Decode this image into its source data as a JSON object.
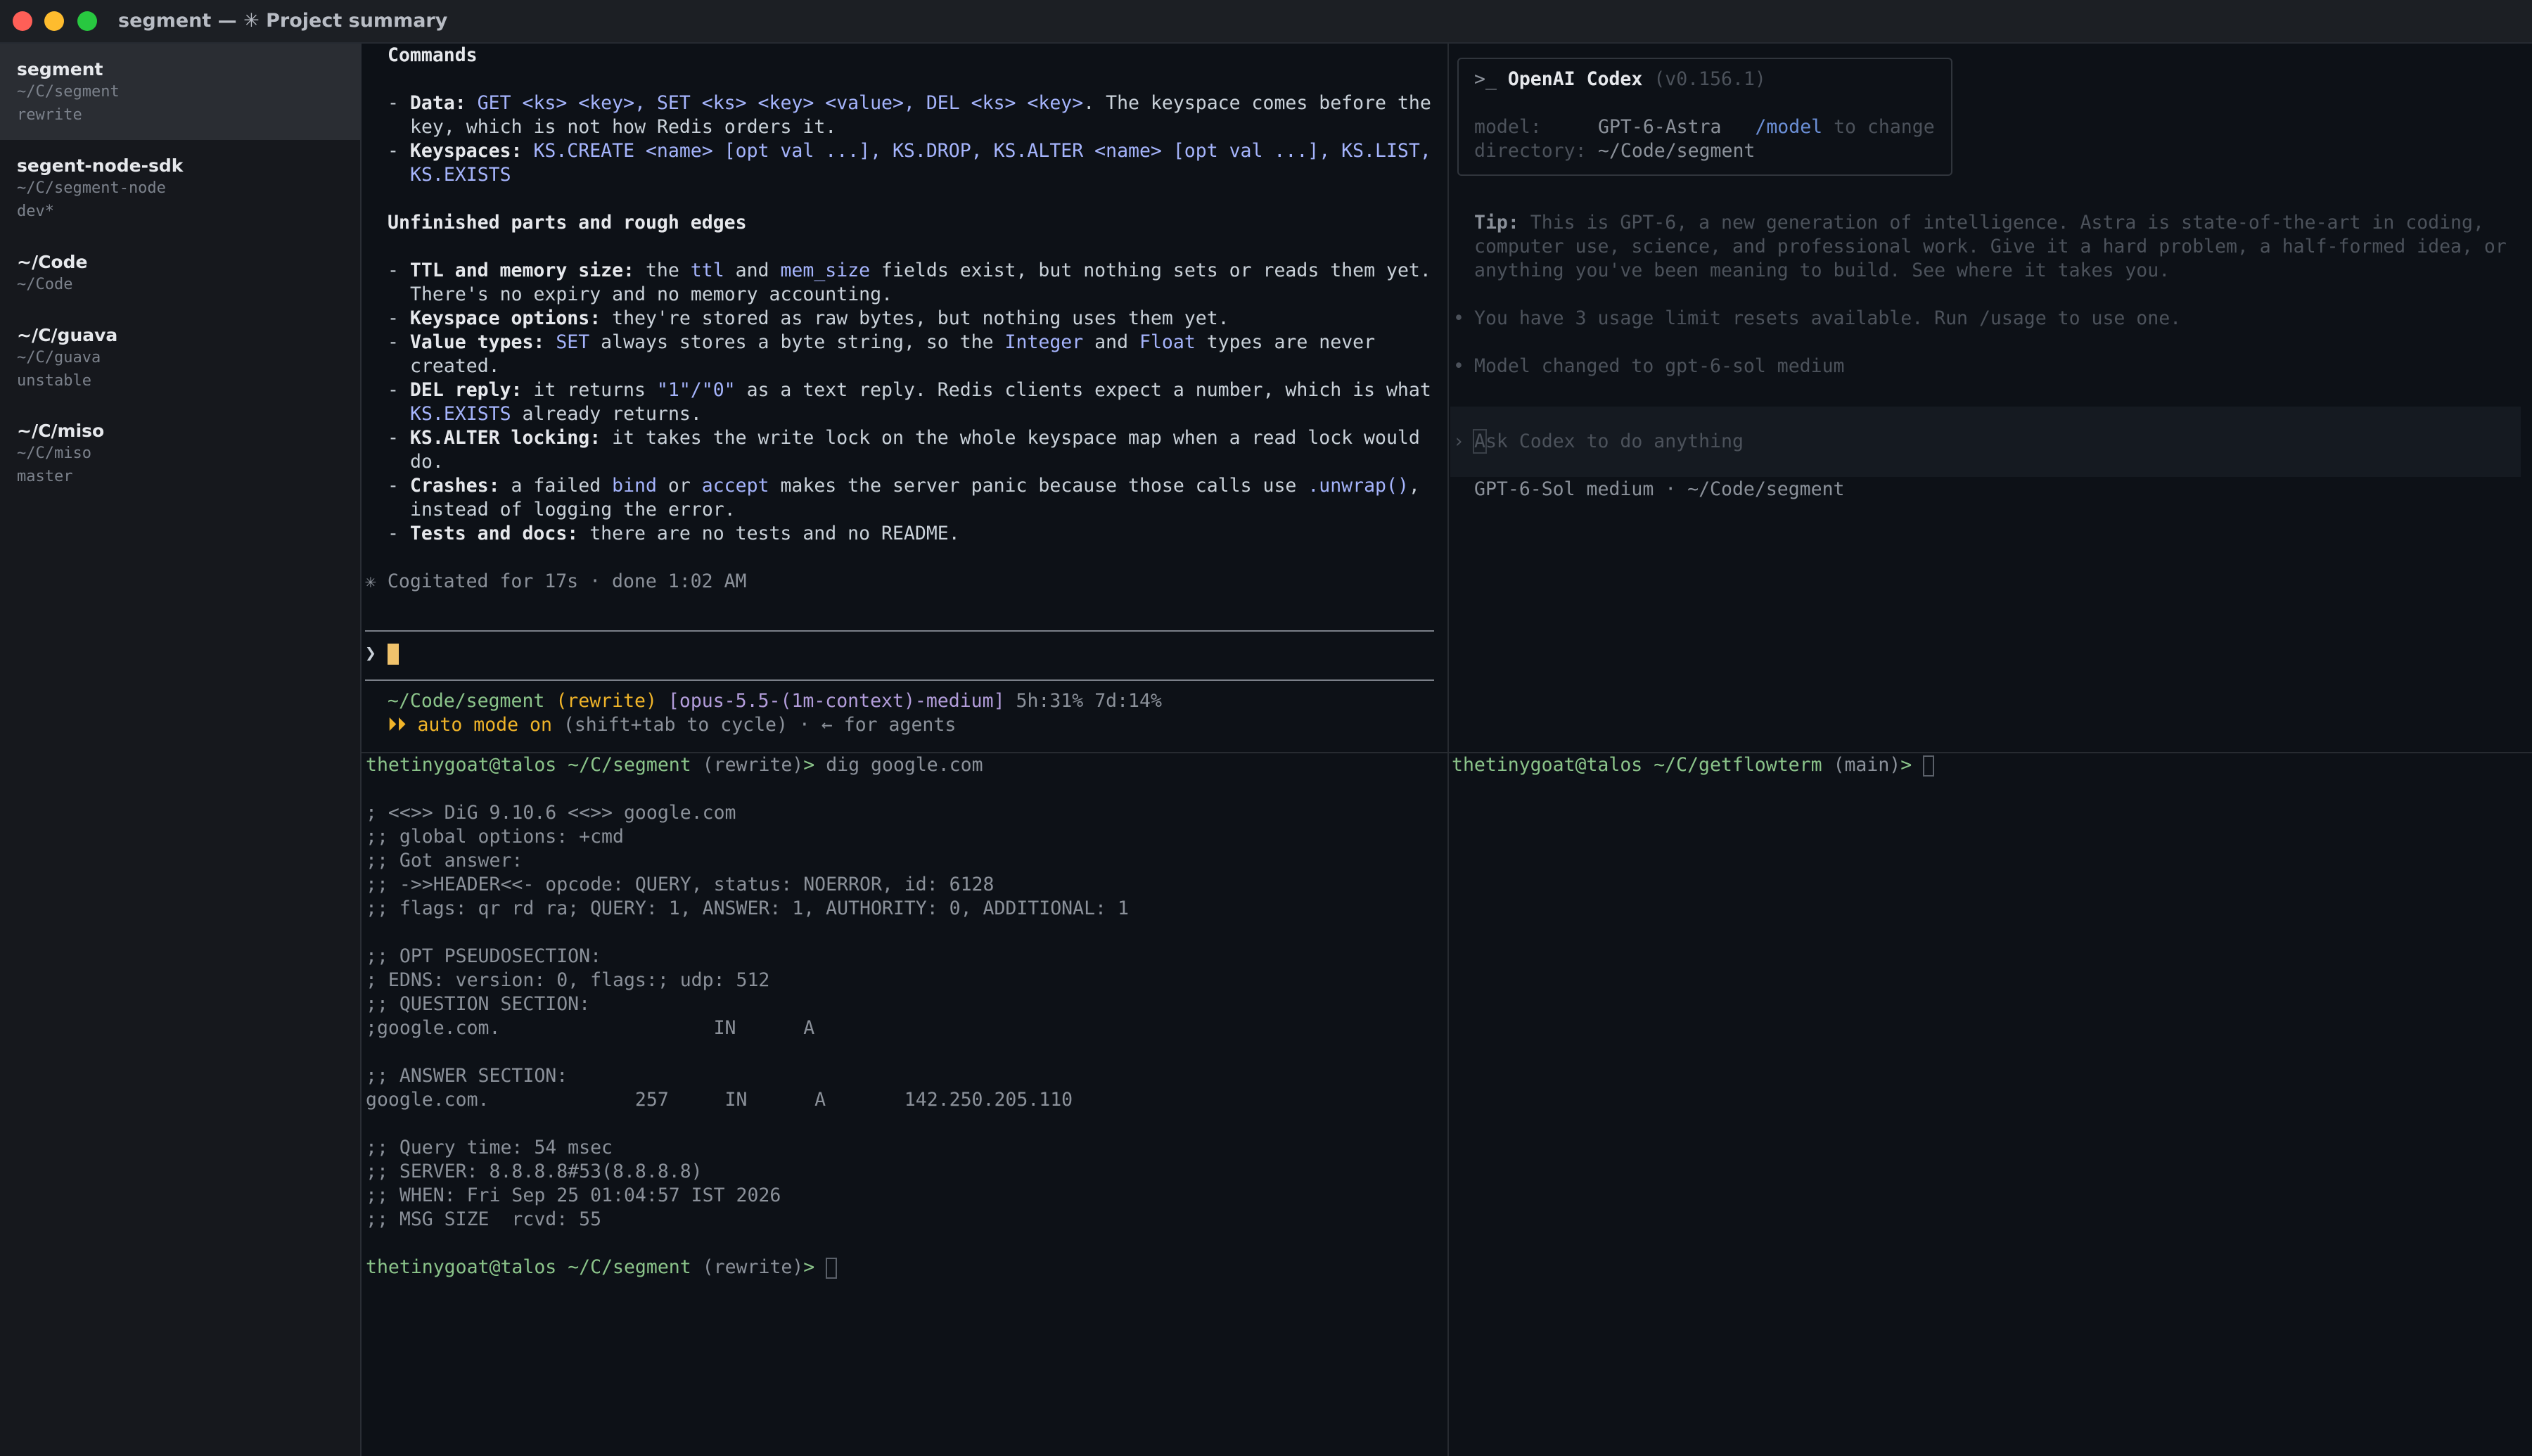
{
  "window": {
    "title": "segment — ✳ Project summary",
    "traffic_lights": {
      "close": "#ff5f57",
      "minimize": "#febc2e",
      "zoom": "#28c840"
    }
  },
  "sidebar": {
    "items": [
      {
        "name": "segment",
        "path": "~/C/segment",
        "branch": "rewrite",
        "active": true
      },
      {
        "name": "segent-node-sdk",
        "path": "~/C/segment-node",
        "branch": "dev*"
      },
      {
        "name": "~/Code",
        "path": "~/Code",
        "branch": ""
      },
      {
        "name": "~/C/guava",
        "path": "~/C/guava",
        "branch": "unstable"
      },
      {
        "name": "~/C/miso",
        "path": "~/C/miso",
        "branch": "master"
      }
    ]
  },
  "claude_pane": {
    "commands_heading": "Commands",
    "data_label": "Data:",
    "data_cmds": "GET <ks> <key>, SET <ks> <key> <value>, DEL <ks> <key>",
    "data_note_1": ". The keyspace comes before the",
    "data_note_2": "key, which is not how Redis orders it.",
    "ks_label": "Keyspaces:",
    "ks_cmds_1": "KS.CREATE <name> [opt val ...], KS.DROP, KS.ALTER <name> [opt val ...], KS.LIST,",
    "ks_cmds_2": "KS.EXISTS",
    "unfinished_heading": "Unfinished parts and rough edges",
    "ttl_label": "TTL and memory size:",
    "ttl_the": " the ",
    "ttl_code1": "ttl",
    "ttl_and": " and ",
    "ttl_code2": "mem_size",
    "ttl_rest": " fields exist, but nothing sets or reads them yet.",
    "ttl_line2": "There's no expiry and no memory accounting.",
    "keyspace_label": "Keyspace options:",
    "keyspace_text": " they're stored as raw bytes, but nothing uses them yet.",
    "valuetypes_label": "Value types:",
    "vt_code1": "SET",
    "vt_text1": " always stores a byte string, so the ",
    "vt_code2": "Integer",
    "vt_and": " and ",
    "vt_code3": "Float",
    "vt_text2": " types are never",
    "vt_line2": "created.",
    "del_label": "DEL reply:",
    "del_text1": " it returns ",
    "del_code": "\"1\"/\"0\"",
    "del_text2": " as a text reply. Redis clients expect a number, which is what",
    "del_code2": "KS.EXISTS",
    "del_text3": " already returns.",
    "alter_label": "KS.ALTER locking:",
    "alter_text": " it takes the write lock on the whole keyspace map when a read lock would",
    "alter_line2": "do.",
    "crash_label": "Crashes:",
    "crash_text1": " a failed ",
    "crash_code1": "bind",
    "crash_or": " or ",
    "crash_code2": "accept",
    "crash_text2": " makes the server panic because those calls use ",
    "crash_code3": ".unwrap()",
    "crash_comma": ",",
    "crash_line2": "instead of logging the error.",
    "tests_label": "Tests and docs:",
    "tests_text": " there are no tests and no README.",
    "dash": "- ",
    "cogitated": "✳ Cogitated for 17s · done 1:02 AM",
    "prompt_char": "❯",
    "status_path": "~/Code/segment",
    "status_branch": "(rewrite)",
    "status_model": "[opus-5.5-(1m-context)-medium]",
    "status_usage": "5h:31% 7d:14%",
    "auto_arrows": "⏵⏵",
    "auto_mode": "auto mode on",
    "auto_rest": " (shift+tab to cycle) · ← for agents"
  },
  "codex_pane": {
    "header_prompt": ">_",
    "header_name": "OpenAI Codex",
    "header_version": "(v0.156.1)",
    "model_label": "model:",
    "model_value": "GPT-6-Astra",
    "model_cmd": "/model",
    "model_hint": "to change",
    "dir_label": "directory:",
    "dir_value": "~/Code/segment",
    "tip_label": "Tip:",
    "tip_line1": "This is GPT-6, a new generation of intelligence. Astra is state-of-the-art in coding,",
    "tip_line2": "computer use, science, and professional work. Give it a hard problem, a half-formed idea, or",
    "tip_line3": "anything you've been meaning to build. See where it takes you.",
    "bullet": "•",
    "notice1": "You have 3 usage limit resets available. Run /usage to use one.",
    "notice2": "Model changed to gpt-6-sol medium",
    "input_prompt": "›",
    "input_first_char": "A",
    "input_placeholder": "sk Codex to do anything",
    "footer": "GPT-6-Sol medium · ~/Code/segment"
  },
  "terminal_left": {
    "user_host": "thetinygoat@talos",
    "path": "~/C/segment",
    "branch": "(rewrite)",
    "prompt_sym": ">",
    "command": "dig google.com",
    "output": [
      "; <<>> DiG 9.10.6 <<>> google.com",
      ";; global options: +cmd",
      ";; Got answer:",
      ";; ->>HEADER<<- opcode: QUERY, status: NOERROR, id: 6128",
      ";; flags: qr rd ra; QUERY: 1, ANSWER: 1, AUTHORITY: 0, ADDITIONAL: 1",
      "",
      ";; OPT PSEUDOSECTION:",
      "; EDNS: version: 0, flags:; udp: 512",
      ";; QUESTION SECTION:",
      ";google.com.                   IN      A",
      "",
      ";; ANSWER SECTION:",
      "google.com.             257     IN      A       142.250.205.110",
      "",
      ";; Query time: 54 msec",
      ";; SERVER: 8.8.8.8#53(8.8.8.8)",
      ";; WHEN: Fri Sep 25 01:04:57 IST 2026",
      ";; MSG SIZE  rcvd: 55"
    ]
  },
  "terminal_right": {
    "user_host": "thetinygoat@talos",
    "path": "~/C/getflowterm",
    "branch": "(main)",
    "prompt_sym": ">"
  }
}
